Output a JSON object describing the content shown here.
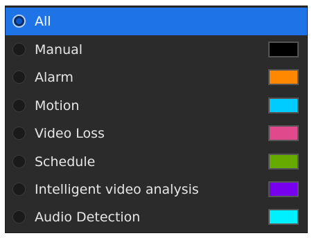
{
  "filter_list": {
    "items": [
      {
        "label": "All",
        "selected": true,
        "color": null
      },
      {
        "label": "Manual",
        "selected": false,
        "color": "#000000"
      },
      {
        "label": "Alarm",
        "selected": false,
        "color": "#ff8800"
      },
      {
        "label": "Motion",
        "selected": false,
        "color": "#00ccff"
      },
      {
        "label": "Video Loss",
        "selected": false,
        "color": "#e04a8c"
      },
      {
        "label": "Schedule",
        "selected": false,
        "color": "#66aa00"
      },
      {
        "label": "Intelligent video analysis",
        "selected": false,
        "color": "#7700ee"
      },
      {
        "label": "Audio Detection",
        "selected": false,
        "color": "#00f0ff"
      }
    ]
  }
}
